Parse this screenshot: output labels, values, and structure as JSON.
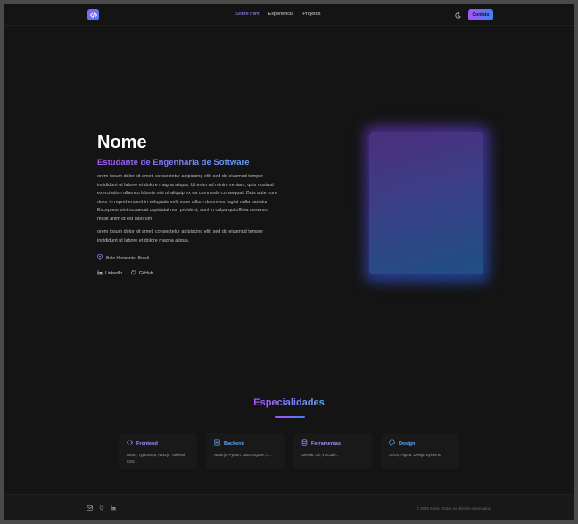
{
  "header": {
    "logo_icon": "code-icon",
    "nav": [
      {
        "label": "Sobre mim",
        "active": true
      },
      {
        "label": "Experiência",
        "active": false
      },
      {
        "label": "Projetos",
        "active": false
      }
    ],
    "theme_icon": "moon-icon",
    "contact_label": "Contato"
  },
  "hero": {
    "name": "Nome",
    "role": "Estudante de Engenharia de Software",
    "bio_1": "orem ipsum dolor sit amet, consectetur adipiscing elit, sed do eiusmod tempor incididunt ut labore et dolore magna aliqua. Ut enim ad minim veniam, quis nostrud exercitation ullamco laboris nisi ut aliquip ex ea commodo consequat. Duis aute irure dolor in reprehenderit in voluptate velit esse cillum dolore eu fugiat nulla pariatur. Excepteur sint occaecat cupidatat non proident, sunt in culpa qui officia deserunt mollit anim id est laborum",
    "bio_2": "orem ipsum dolor sit amet, consectetur adipiscing elit, sed do eiusmod tempor incididunt ut labore et dolore magna aliqua.",
    "location": "Belo Horizonte, Brasil",
    "socials": [
      {
        "label": "LinkedIn",
        "icon": "linkedin-icon"
      },
      {
        "label": "GitHub",
        "icon": "github-icon"
      }
    ]
  },
  "specialties": {
    "title": "Especialidades",
    "cards": [
      {
        "title": "Frontend",
        "icon": "code-icon",
        "color": "#a78bfa",
        "desc": "React, TypeScript, Next.js, Tailwind CSS"
      },
      {
        "title": "Backend",
        "icon": "server-icon",
        "color": "#60a5fa",
        "desc": "Node.js, Python, Java, SQLite, C..."
      },
      {
        "title": "Ferramentas",
        "icon": "database-icon",
        "color": "#a78bfa",
        "desc": "GitHub, Git, VSCode..."
      },
      {
        "title": "Design",
        "icon": "palette-icon",
        "color": "#60a5fa",
        "desc": "UI/UX, Figma, Design Systems"
      }
    ]
  },
  "footer": {
    "icons": [
      "mail-icon",
      "github-icon",
      "linkedin-icon"
    ],
    "copyright": "© 2025 nome. Todos os direitos reservados."
  },
  "colors": {
    "accent_purple": "#a855f7",
    "accent_blue": "#3b82f6",
    "background": "#141414"
  }
}
